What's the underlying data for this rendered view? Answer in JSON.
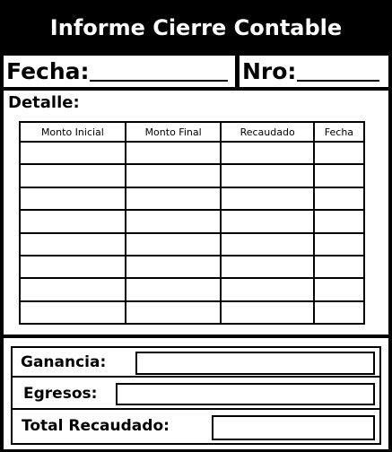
{
  "title": "Informe Cierre Contable",
  "header": {
    "fecha_label": "Fecha:",
    "nro_label": "Nro:"
  },
  "detalle": {
    "label": "Detalle:",
    "columns": [
      "Monto Inicial",
      "Monto Final",
      "Recaudado",
      "Fecha"
    ]
  },
  "summary": {
    "ganancia_label": "Ganancia:",
    "egresos_label": "Egresos:",
    "total_label": "Total Recaudado:"
  }
}
